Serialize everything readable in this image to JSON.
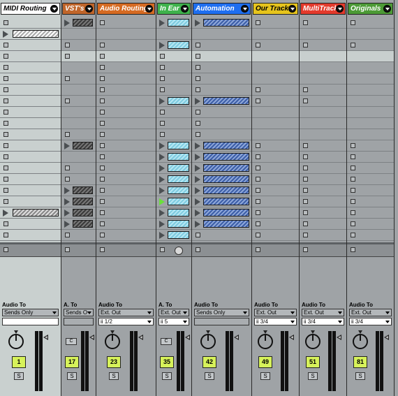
{
  "colors": {
    "midi_routing": "#ffffff",
    "vsts": "#c0652a",
    "audio_routing": "#d56a22",
    "in_ear": "#3fb24c",
    "automation": "#1e6ef0",
    "our_tracks": "#e6c41c",
    "multitrack": "#e33a2c",
    "originals": "#4c9a36"
  },
  "tracks": [
    {
      "name": "MIDI Routing",
      "track_number": "1",
      "io_label": "Audio To",
      "dd1": "Sends Only",
      "dd2": "",
      "has_c": false
    },
    {
      "name": "VST's",
      "track_number": "17",
      "io_label": "A. To",
      "dd1": "Sends O",
      "dd2": "",
      "has_c": true
    },
    {
      "name": "Audio Routing",
      "track_number": "23",
      "io_label": "Audio To",
      "dd1": "Ext. Out",
      "dd2": "ii 1/2",
      "has_c": false
    },
    {
      "name": "In Ear",
      "track_number": "35",
      "io_label": "A. To",
      "dd1": "Ext. Out",
      "dd2": "ii 5",
      "has_c": true
    },
    {
      "name": "Automation",
      "track_number": "42",
      "io_label": "Audio To",
      "dd1": "Sends Only",
      "dd2": "",
      "has_c": false
    },
    {
      "name": "Our Tracks",
      "track_number": "49",
      "io_label": "Audio To",
      "dd1": "Ext. Out",
      "dd2": "ii 3/4",
      "has_c": false
    },
    {
      "name": "MultiTrack",
      "track_number": "51",
      "io_label": "Audio To",
      "dd1": "Ext. Out",
      "dd2": "ii 3/4",
      "has_c": false
    },
    {
      "name": "Originals",
      "track_number": "81",
      "io_label": "Audio To",
      "dd1": "Ext. Out",
      "dd2": "ii 3/4",
      "has_c": false
    }
  ],
  "solo_label": "S",
  "cue_label": "C"
}
